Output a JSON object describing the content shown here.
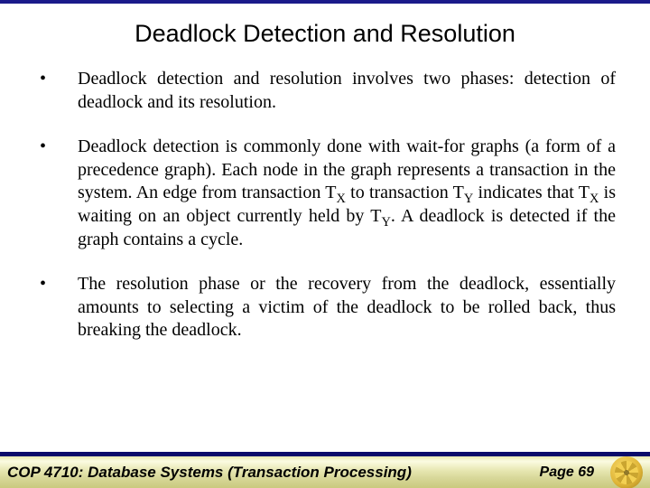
{
  "title": "Deadlock Detection and Resolution",
  "bullets": {
    "b1": "Deadlock detection and resolution involves two phases: detection of deadlock and its resolution.",
    "b2_pre": "Deadlock detection is commonly done with wait-for graphs (a form of a precedence graph).  Each node in the graph represents a transaction in the system.  An edge from transaction T",
    "b2_x1": "X",
    "b2_mid1": " to transaction T",
    "b2_y1": "Y",
    "b2_mid2": " indicates that T",
    "b2_x2": "X",
    "b2_mid3": " is waiting on an object currently held by T",
    "b2_y2": "Y",
    "b2_post": ".  A deadlock is detected if the graph contains a cycle.",
    "b3": "The resolution phase or the recovery from the deadlock, essentially amounts to selecting a victim of the deadlock to be rolled back, thus breaking the deadlock."
  },
  "footer": {
    "course": "COP 4710: Database Systems  (Transaction Processing)",
    "page": "Page 69"
  }
}
